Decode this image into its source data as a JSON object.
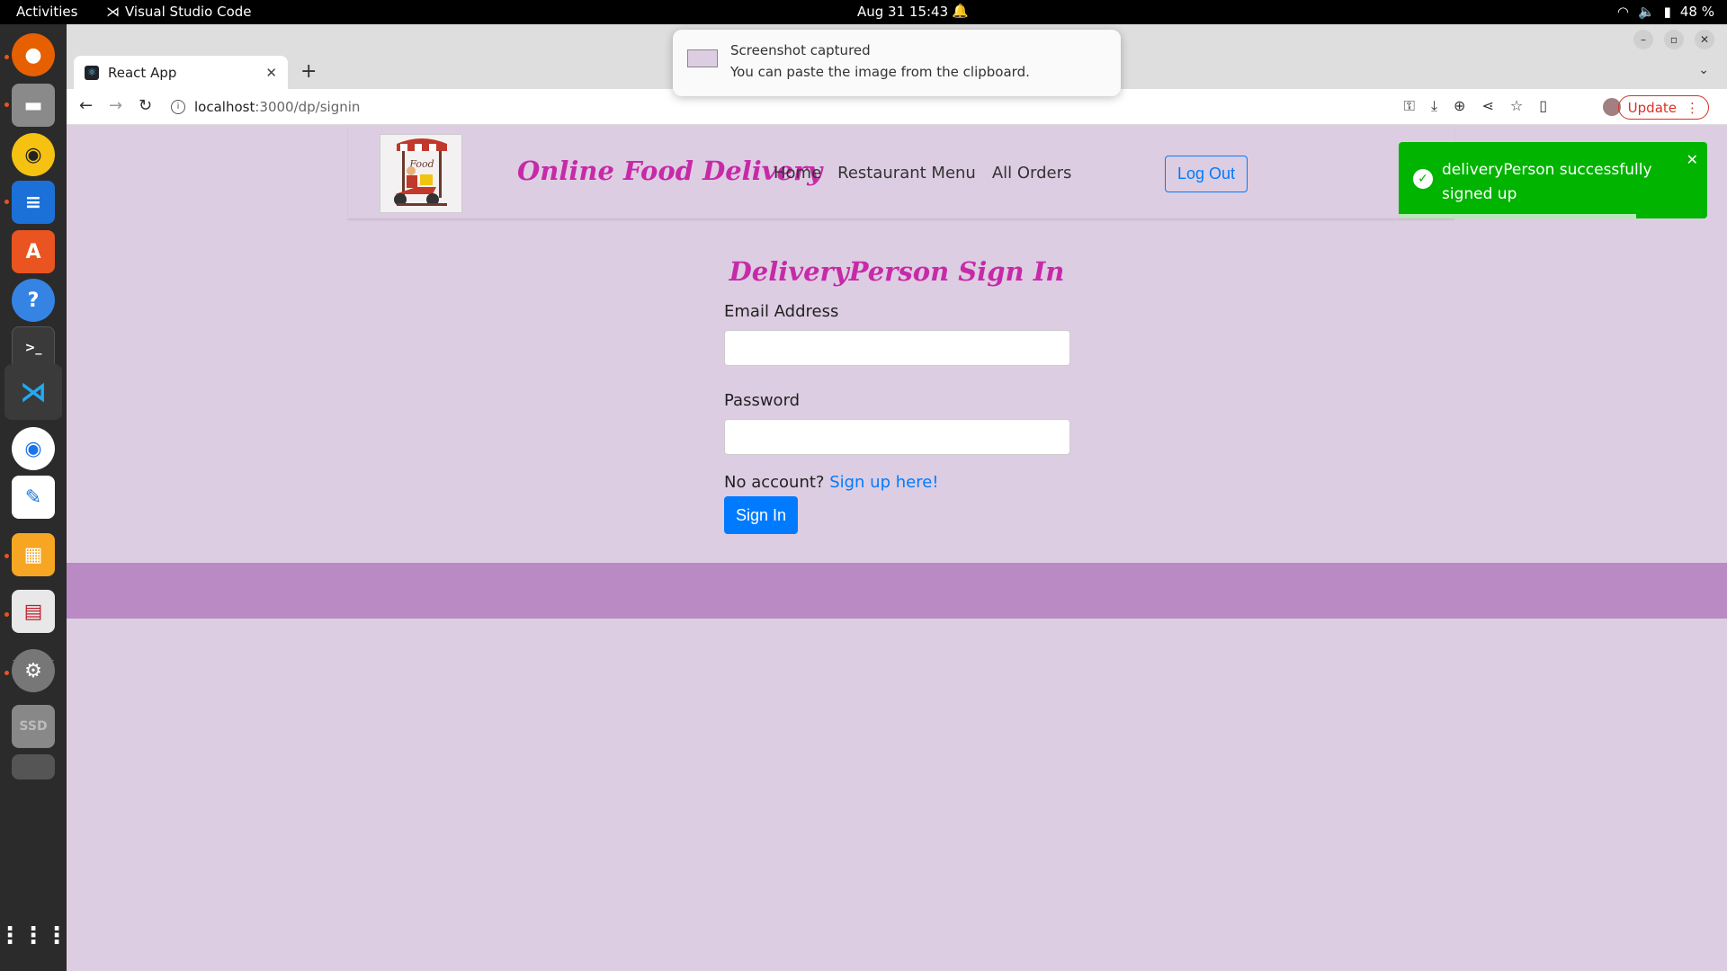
{
  "topbar": {
    "activities": "Activities",
    "app_name": "Visual Studio Code",
    "clock": "Aug 31  15:43",
    "battery": "48 %"
  },
  "dock": {
    "items": [
      "firefox-icon",
      "files-icon",
      "rhythmbox-icon",
      "writer-icon",
      "app-center-icon",
      "help-icon",
      "terminal-icon",
      "vscode-icon",
      "chrome-icon",
      "text-editor-icon",
      "impress-icon",
      "document-viewer-icon",
      "settings-icon",
      "ssd-drive-icon",
      "drive-icon",
      "app-grid-icon"
    ]
  },
  "browser": {
    "tab_title": "React App",
    "url_host": "localhost",
    "url_path": ":3000/dp/signin",
    "update_label": "Update"
  },
  "notification": {
    "title": "Screenshot captured",
    "body": "You can paste the image from the clipboard."
  },
  "navbar": {
    "brand": "Online Food Delivery",
    "links": [
      "Home",
      "Restaurant Menu",
      "All Orders"
    ],
    "logout": "Log Out"
  },
  "form": {
    "title": "DeliveryPerson Sign In",
    "email_label": "Email Address",
    "email_value": "",
    "password_label": "Password",
    "password_value": "",
    "no_account_text": "No account?",
    "signup_link": "Sign up here!",
    "submit": "Sign In"
  },
  "toast": {
    "message": "deliveryPerson successfully signed up",
    "progress": 0.77
  },
  "colors": {
    "page_bg": "#ddcde2",
    "footer_bg": "#b98ac3",
    "brand": "#c72aa8",
    "primary": "#007bff",
    "toast_bg": "#00b400"
  }
}
